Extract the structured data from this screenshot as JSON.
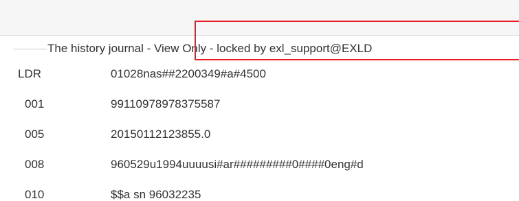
{
  "record": {
    "title": "The history journal - View Only - locked by exl_support@EXLD",
    "fields": [
      {
        "tag": "LDR",
        "value": "01028nas##2200349#a#4500"
      },
      {
        "tag": "001",
        "value": "99110978978375587"
      },
      {
        "tag": "005",
        "value": "20150112123855.0"
      },
      {
        "tag": "008",
        "value": "960529u1994uuuusi#ar#########0####0eng#d"
      },
      {
        "tag": "010",
        "value": "$$a sn 96032235"
      }
    ]
  },
  "colors": {
    "highlight": "#ee1c24",
    "text": "#333333",
    "toolbar": "#f6f6f6"
  }
}
